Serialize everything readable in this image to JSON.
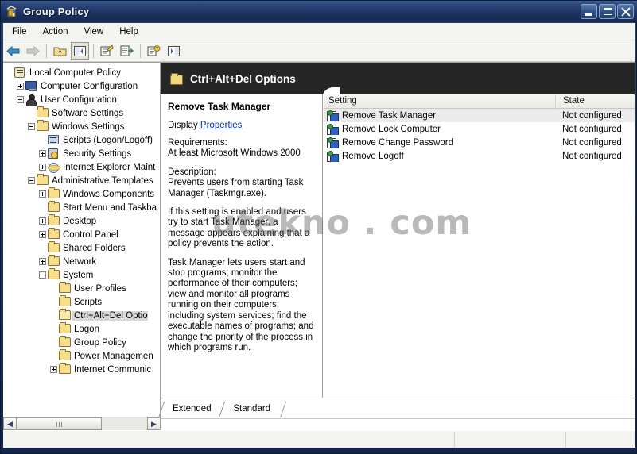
{
  "window": {
    "title": "Group Policy",
    "icon": "group-policy-icon",
    "buttons": {
      "minimize": "Minimize",
      "maximize": "Maximize",
      "close": "Close"
    }
  },
  "menubar": {
    "items": [
      "File",
      "Action",
      "View",
      "Help"
    ]
  },
  "toolbar": {
    "buttons": [
      {
        "name": "back-button",
        "icon": "left-arrow-icon"
      },
      {
        "name": "forward-button",
        "icon": "right-arrow-icon"
      },
      {
        "name": "up-one-level-button",
        "icon": "folder-up-icon"
      },
      {
        "name": "show-hide-console-tree-button",
        "icon": "console-tree-icon"
      },
      {
        "name": "properties-button",
        "icon": "properties-icon"
      },
      {
        "name": "export-list-button",
        "icon": "export-list-icon"
      },
      {
        "name": "help-button",
        "icon": "help-document-icon"
      },
      {
        "name": "show-hide-action-pane-button",
        "icon": "action-pane-icon"
      }
    ]
  },
  "tree": {
    "nodes": [
      {
        "label": "Local Computer Policy",
        "indent": 0,
        "toggle": "none",
        "icon": "policy-icon",
        "selected": false
      },
      {
        "label": "Computer Configuration",
        "indent": 1,
        "toggle": "plus",
        "icon": "computer-icon",
        "selected": false
      },
      {
        "label": "User Configuration",
        "indent": 1,
        "toggle": "minus",
        "icon": "user-icon",
        "selected": false
      },
      {
        "label": "Software Settings",
        "indent": 2,
        "toggle": "none",
        "icon": "folder-icon",
        "selected": false
      },
      {
        "label": "Windows Settings",
        "indent": 2,
        "toggle": "minus",
        "icon": "folder-icon",
        "selected": false
      },
      {
        "label": "Scripts (Logon/Logoff)",
        "indent": 3,
        "toggle": "none",
        "icon": "script-icon",
        "selected": false
      },
      {
        "label": "Security Settings",
        "indent": 3,
        "toggle": "plus",
        "icon": "security-icon",
        "selected": false
      },
      {
        "label": "Internet Explorer Maint",
        "indent": 3,
        "toggle": "plus",
        "icon": "ie-icon",
        "selected": false
      },
      {
        "label": "Administrative Templates",
        "indent": 2,
        "toggle": "minus",
        "icon": "folder-icon",
        "selected": false
      },
      {
        "label": "Windows Components",
        "indent": 3,
        "toggle": "plus",
        "icon": "folder-icon",
        "selected": false
      },
      {
        "label": "Start Menu and Taskba",
        "indent": 3,
        "toggle": "none",
        "icon": "folder-icon",
        "selected": false
      },
      {
        "label": "Desktop",
        "indent": 3,
        "toggle": "plus",
        "icon": "folder-icon",
        "selected": false
      },
      {
        "label": "Control Panel",
        "indent": 3,
        "toggle": "plus",
        "icon": "folder-icon",
        "selected": false
      },
      {
        "label": "Shared Folders",
        "indent": 3,
        "toggle": "none",
        "icon": "folder-icon",
        "selected": false
      },
      {
        "label": "Network",
        "indent": 3,
        "toggle": "plus",
        "icon": "folder-icon",
        "selected": false
      },
      {
        "label": "System",
        "indent": 3,
        "toggle": "minus",
        "icon": "folder-icon",
        "selected": false
      },
      {
        "label": "User Profiles",
        "indent": 4,
        "toggle": "none",
        "icon": "folder-icon",
        "selected": false
      },
      {
        "label": "Scripts",
        "indent": 4,
        "toggle": "none",
        "icon": "folder-icon",
        "selected": false
      },
      {
        "label": "Ctrl+Alt+Del Optio",
        "indent": 4,
        "toggle": "none",
        "icon": "folder-open-icon",
        "selected": true
      },
      {
        "label": "Logon",
        "indent": 4,
        "toggle": "none",
        "icon": "folder-icon",
        "selected": false
      },
      {
        "label": "Group Policy",
        "indent": 4,
        "toggle": "none",
        "icon": "folder-icon",
        "selected": false
      },
      {
        "label": "Power Managemen",
        "indent": 4,
        "toggle": "none",
        "icon": "folder-icon",
        "selected": false
      },
      {
        "label": "Internet Communic",
        "indent": 4,
        "toggle": "plus",
        "icon": "folder-icon",
        "selected": false
      }
    ],
    "hscroll": {
      "left_arrow": "◀",
      "right_arrow": "▶"
    }
  },
  "right_pane": {
    "header_title": "Ctrl+Alt+Del Options",
    "header_icon": "folder-icon"
  },
  "description": {
    "title": "Remove Task Manager",
    "display_label": "Display",
    "properties_link": "Properties",
    "requirements_label": "Requirements:",
    "requirements_value": "At least Microsoft Windows 2000",
    "description_label": "Description:",
    "description_p1": "Prevents users from starting Task Manager (Taskmgr.exe).",
    "description_p2": "If this setting is enabled and users try to start Task Manager, a message appears explaining that a policy prevents the action.",
    "description_p3": "Task Manager lets users start and stop programs; monitor the performance of their computers; view and monitor all programs running on their computers, including system services; find the executable names of programs; and change the priority of the process in which programs run."
  },
  "listview": {
    "columns": [
      "Setting",
      "State"
    ],
    "rows": [
      {
        "setting": "Remove Task Manager",
        "state": "Not configured",
        "highlighted": true
      },
      {
        "setting": "Remove Lock Computer",
        "state": "Not configured",
        "highlighted": false
      },
      {
        "setting": "Remove Change Password",
        "state": "Not configured",
        "highlighted": false
      },
      {
        "setting": "Remove Logoff",
        "state": "Not configured",
        "highlighted": false
      }
    ]
  },
  "tabs": [
    {
      "label": "Extended",
      "active": false
    },
    {
      "label": "Standard",
      "active": true
    }
  ],
  "statusbar": {
    "panel1": "",
    "panel2": "",
    "panel3": ""
  },
  "watermark": {
    "text": "utekno . com"
  },
  "colors": {
    "title_bar": "#27406b",
    "header_dark": "#262626",
    "link": "#0a32a8",
    "row_highlight": "#ebebeb",
    "folder_yellow": "#f7dd8c"
  }
}
